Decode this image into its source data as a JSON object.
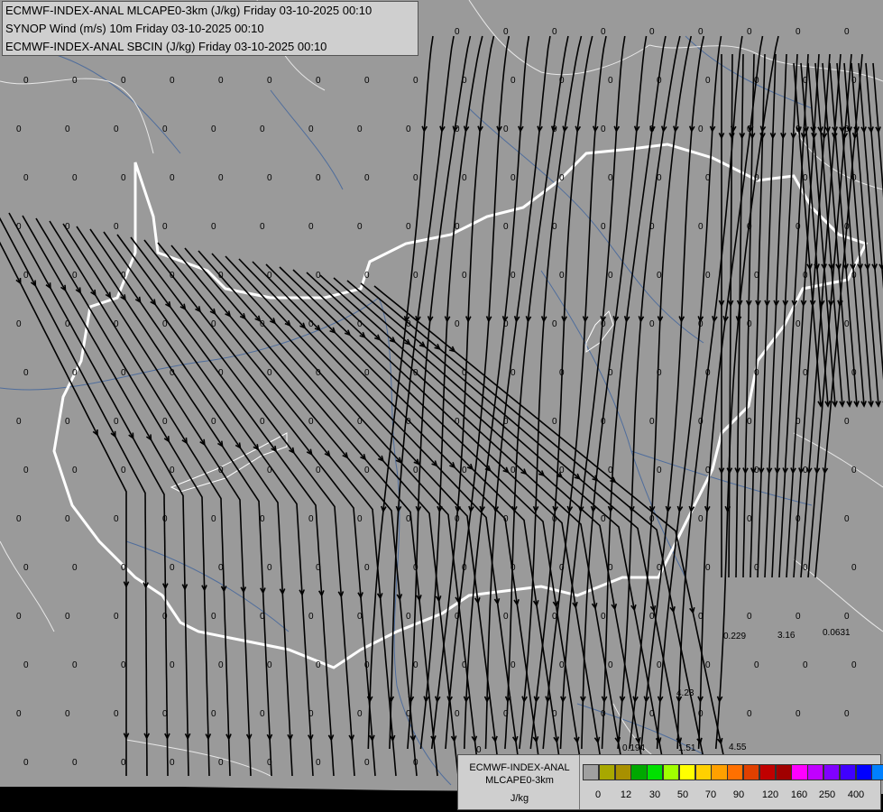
{
  "header": {
    "lines": [
      "ECMWF-INDEX-ANAL MLCAPE0-3km (J/kg) Friday 03-10-2025 00:10",
      "SYNOP Wind (m/s) 10m Friday 03-10-2025 00:10",
      "ECMWF-INDEX-ANAL SBCIN (J/kg) Friday 03-10-2025 00:10"
    ]
  },
  "colorbar": {
    "title_line1": "ECMWF-INDEX-ANAL",
    "title_line2": "MLCAPE0-3km",
    "unit": "J/kg",
    "colors": [
      "#a0a0a0",
      "#a8a800",
      "#a89000",
      "#00a800",
      "#00e000",
      "#a0ff00",
      "#ffff00",
      "#ffd000",
      "#ffa000",
      "#ff7000",
      "#e04000",
      "#c00000",
      "#a00000",
      "#ff00ff",
      "#c000ff",
      "#8000ff",
      "#4000ff",
      "#0000ff",
      "#0080ff",
      "#00c0ff",
      "#00ffff",
      "#80ffff",
      "#ffffff"
    ],
    "ticks": [
      "0",
      "12",
      "30",
      "50",
      "70",
      "90",
      "120",
      "160",
      "250",
      "400"
    ]
  },
  "map": {
    "value_labels": [
      {
        "t": "0"
      },
      {
        "t": "0.194"
      },
      {
        "t": "1.51"
      },
      {
        "t": "4.55"
      },
      {
        "t": "0.229"
      },
      {
        "t": "3.16"
      },
      {
        "t": "0.0631"
      },
      {
        "t": "4.23"
      }
    ]
  }
}
